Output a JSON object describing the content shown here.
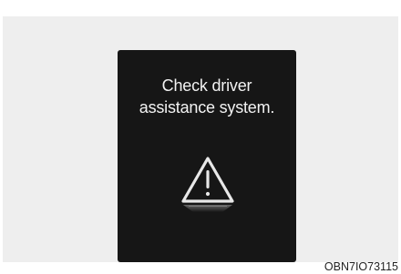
{
  "display": {
    "message_line1": "Check driver",
    "message_line2": "assistance system.",
    "icon": "warning-triangle-icon"
  },
  "figure": {
    "code": "OBN7IO73115"
  },
  "colors": {
    "screen_background": "#161616",
    "text": "#f2f2f2",
    "icon_stroke": "#e8e8e8",
    "panel_background": "#eeeeee"
  }
}
